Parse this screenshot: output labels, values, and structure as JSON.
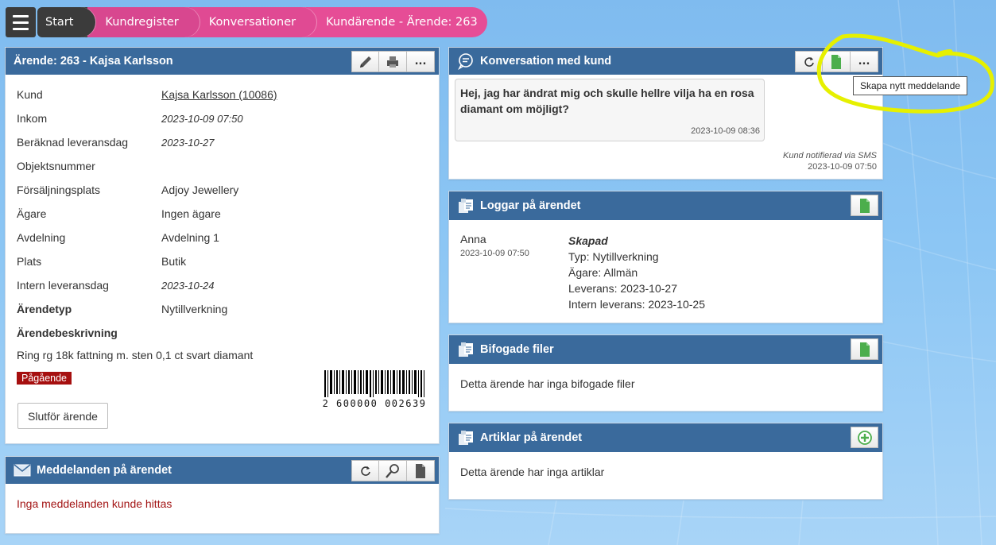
{
  "nav": {
    "start": "Start",
    "crumbs": [
      "Kundregister",
      "Konversationer",
      "Kundärende - Ärende: 263"
    ]
  },
  "case_panel": {
    "title": "Ärende: 263 - Kajsa Karlsson",
    "rows": [
      {
        "label": "Kund",
        "value": "Kajsa Karlsson (10086)"
      },
      {
        "label": "Inkom",
        "value": "2023-10-09 07:50"
      },
      {
        "label": "Beräknad leveransdag",
        "value": "2023-10-27"
      },
      {
        "label": "Objektsnummer",
        "value": ""
      },
      {
        "label": "Försäljningsplats",
        "value": "Adjoy Jewellery"
      },
      {
        "label": "Ägare",
        "value": "Ingen ägare"
      },
      {
        "label": "Avdelning",
        "value": "Avdelning 1"
      },
      {
        "label": "Plats",
        "value": "Butik"
      },
      {
        "label": "Intern leveransdag",
        "value": "2023-10-24"
      },
      {
        "label": "Ärendetyp",
        "value": "Nytillverkning"
      }
    ],
    "description_label": "Ärendebeskrivning",
    "description": "Ring rg 18k fattning m. sten 0,1 ct svart diamant",
    "status": "Pågående",
    "finish_button": "Slutför ärende",
    "barcode_number": "2 600000 002639",
    "more_label": "..."
  },
  "messages_panel": {
    "title": "Meddelanden på ärendet",
    "empty": "Inga meddelanden kunde hittas"
  },
  "conversation_panel": {
    "title": "Konversation med kund",
    "more_label": "...",
    "message": {
      "text": "Hej, jag har ändrat mig och skulle hellre vilja ha en rosa diamant om möjligt?",
      "time": "2023-10-09 08:36"
    },
    "notice": "Kund notifierad via SMS",
    "notice_time": "2023-10-09 07:50",
    "tooltip": "Skapa nytt meddelande"
  },
  "logs_panel": {
    "title": "Loggar på ärendet",
    "entry": {
      "user": "Anna",
      "time": "2023-10-09 07:50",
      "heading": "Skapad",
      "lines": [
        "Typ: Nytillverkning",
        "Ägare: Allmän",
        "Leverans: 2023-10-27",
        "Intern leverans: 2023-10-25"
      ]
    }
  },
  "files_panel": {
    "title": "Bifogade filer",
    "empty": "Detta ärende har inga bifogade filer"
  },
  "articles_panel": {
    "title": "Artiklar på ärendet",
    "empty": "Detta ärende har inga artiklar"
  },
  "colors": {
    "panel_header": "#3a6a9c",
    "breadcrumb": "#e04a93",
    "status": "#a60f0f",
    "highlight": "#e6f000"
  }
}
